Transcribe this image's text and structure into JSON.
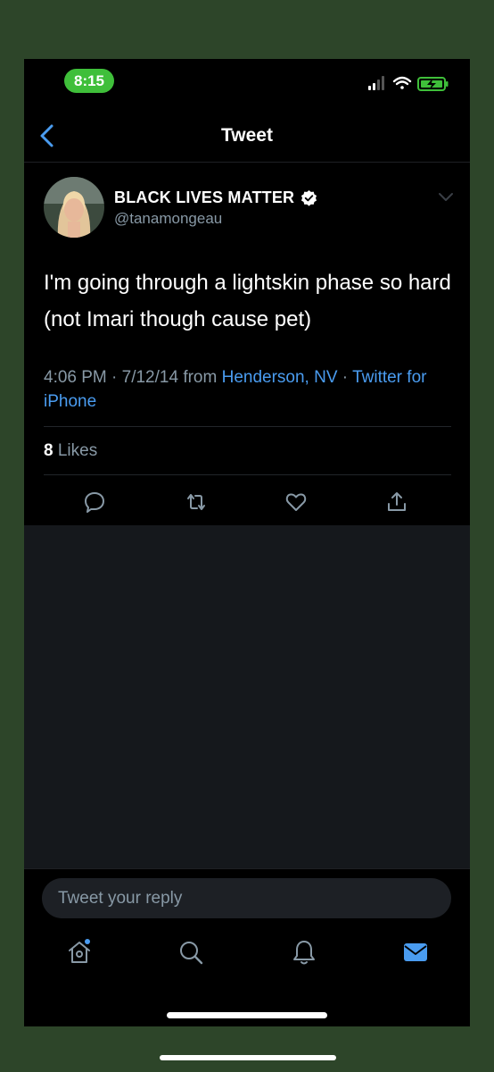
{
  "status_bar": {
    "time": "8:15"
  },
  "nav": {
    "title": "Tweet"
  },
  "tweet": {
    "display_name": "BLACK LIVES MATTER",
    "handle": "@tanamongeau",
    "text": "I'm going through a lightskin phase so hard (not Imari though cause pet)",
    "timestamp": "4:06 PM · 7/12/14",
    "from_label": " from ",
    "location": "Henderson, NV",
    "separator": " · ",
    "client": "Twitter for iPhone",
    "likes_count": "8",
    "likes_label": " Likes"
  },
  "reply": {
    "placeholder": "Tweet your reply"
  },
  "tabs": [
    "home-icon",
    "search-icon",
    "notifications-icon",
    "messages-icon"
  ],
  "colors": {
    "accent": "#4a9cf0",
    "background": "#000000",
    "muted": "#8899a6",
    "status_pill": "#3fbf3a",
    "outer": "#2d4529"
  }
}
